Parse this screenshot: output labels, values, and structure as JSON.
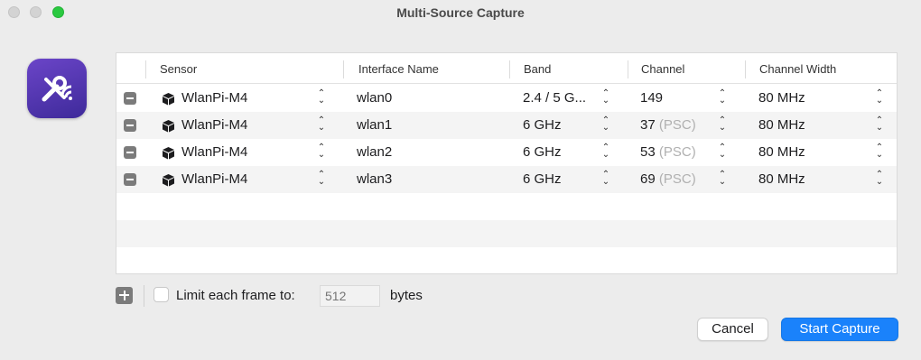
{
  "window": {
    "title": "Multi-Source Capture"
  },
  "app_icon": "wifi-tools-icon",
  "table": {
    "columns": [
      "Sensor",
      "Interface Name",
      "Band",
      "Channel",
      "Channel Width"
    ],
    "rows": [
      {
        "sensor": "WlanPi-M4",
        "interface": "wlan0",
        "band": "2.4 / 5 G...",
        "channel": "149",
        "channel_suffix": "",
        "width": "80 MHz"
      },
      {
        "sensor": "WlanPi-M4",
        "interface": "wlan1",
        "band": "6 GHz",
        "channel": "37",
        "channel_suffix": "(PSC)",
        "width": "80 MHz"
      },
      {
        "sensor": "WlanPi-M4",
        "interface": "wlan2",
        "band": "6 GHz",
        "channel": "53",
        "channel_suffix": "(PSC)",
        "width": "80 MHz"
      },
      {
        "sensor": "WlanPi-M4",
        "interface": "wlan3",
        "band": "6 GHz",
        "channel": "69",
        "channel_suffix": "(PSC)",
        "width": "80 MHz"
      }
    ]
  },
  "footer": {
    "limit_label": "Limit each frame to:",
    "limit_placeholder": "512",
    "limit_checked": false,
    "bytes_label": "bytes"
  },
  "buttons": {
    "cancel": "Cancel",
    "start": "Start Capture"
  },
  "colors": {
    "accent": "#1a82fb",
    "app_icon": "#5236b0",
    "zoom_button": "#2ac940"
  }
}
